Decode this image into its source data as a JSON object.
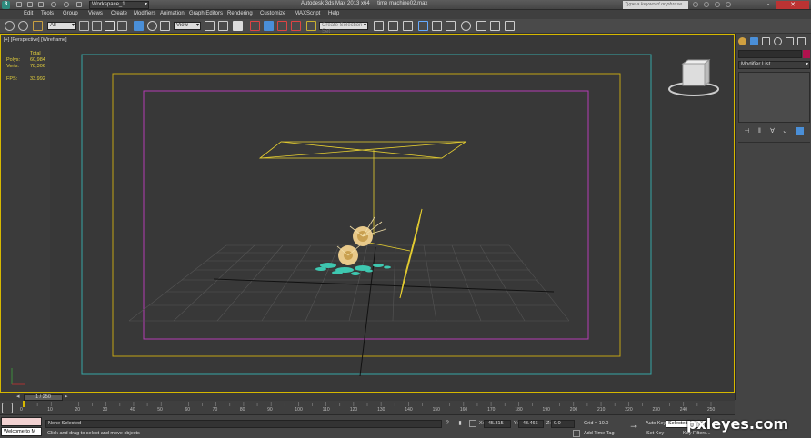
{
  "titlebar": {
    "workspace": "Workspace_1",
    "title": "Autodesk 3ds Max 2013 x64",
    "filename": "time machine02.max",
    "search_placeholder": "Type a keyword or phrase"
  },
  "menu": [
    "Edit",
    "Tools",
    "Group",
    "Views",
    "Create",
    "Modifiers",
    "Animation",
    "Graph Editors",
    "Rendering",
    "Customize",
    "MAXScript",
    "Help"
  ],
  "toolbar": {
    "selection_filter": "All",
    "ref_coord": "View",
    "named_selection": "Create Selection Set"
  },
  "viewport": {
    "label": "[+] [Perspective] [Wireframe]",
    "stats": {
      "total_label": "Total",
      "polys_label": "Polys:",
      "polys_value": "60,984",
      "verts_label": "Verts:",
      "verts_value": "78,306",
      "fps_label": "FPS:",
      "fps_value": "33.992"
    },
    "colors": {
      "border": "#d6b800",
      "safe_outer": "#36a6a6",
      "safe_mid": "#c2a415",
      "safe_inner": "#b43cb4",
      "wire": "#e8d030",
      "particles": "#3ec7b0"
    }
  },
  "command_panel": {
    "modifier_list": "Modifier List"
  },
  "timeline": {
    "frame_display": "1 / 250",
    "ticks": [
      "0",
      "10",
      "20",
      "30",
      "40",
      "50",
      "60",
      "70",
      "80",
      "90",
      "100",
      "110",
      "120",
      "130",
      "140",
      "150",
      "160",
      "170",
      "180",
      "190",
      "200",
      "210",
      "220",
      "230",
      "240",
      "250"
    ]
  },
  "status": {
    "listener_text": "Welcome to M",
    "selection": "None Selected",
    "prompt": "Click and drag to select and move objects",
    "x_label": "X:",
    "x_value": "-45.315",
    "y_label": "Y:",
    "y_value": "-43.466",
    "z_label": "Z:",
    "z_value": "0.0",
    "grid": "Grid = 10.0",
    "add_time_tag": "Add Time Tag",
    "auto_key": "Auto Key",
    "set_key": "Set Key",
    "selected": "Selected",
    "key_filters": "Key Filters..."
  },
  "watermark": "pxleyes.com"
}
